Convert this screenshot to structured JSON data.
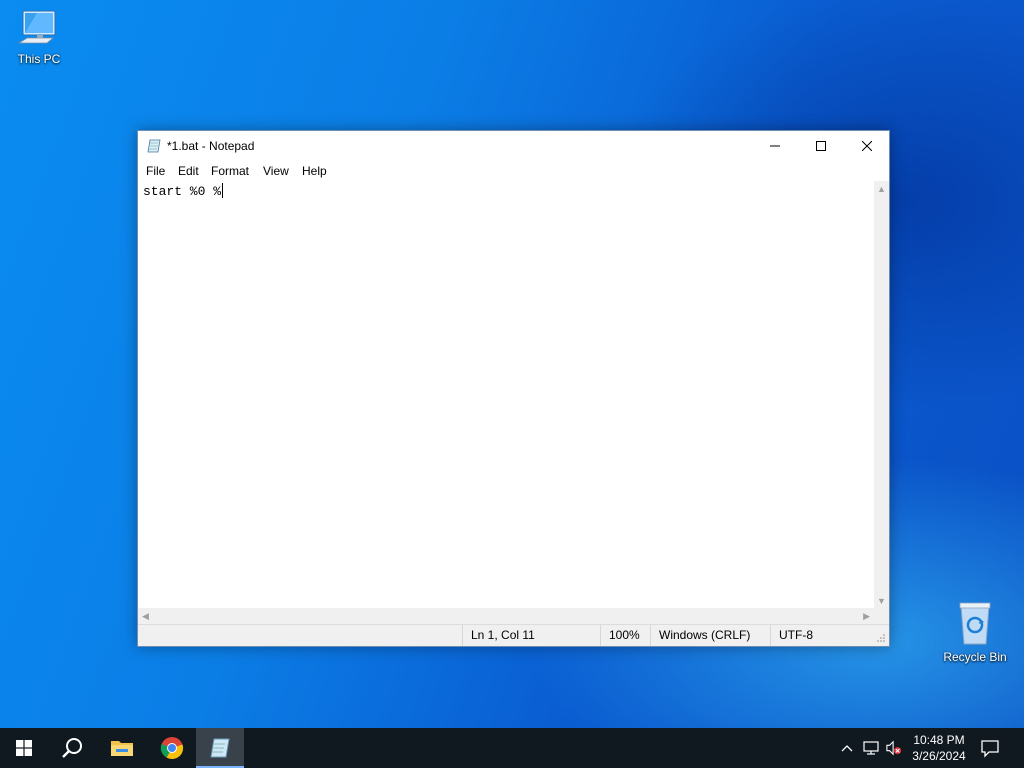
{
  "desktop": {
    "icons": [
      {
        "label": "This PC",
        "icon": "computer-icon"
      },
      {
        "label": "Recycle Bin",
        "icon": "recycle-bin-icon"
      }
    ]
  },
  "window": {
    "title": "*1.bat - Notepad",
    "app_icon": "notepad-icon",
    "controls": {
      "minimize": "minimize-icon",
      "maximize": "maximize-icon",
      "close": "close-icon"
    },
    "menu": [
      "File",
      "Edit",
      "Format",
      "View",
      "Help"
    ],
    "editor_text": "start %0 %",
    "status": {
      "position": "Ln 1, Col 11",
      "zoom": "100%",
      "line_ending": "Windows (CRLF)",
      "encoding": "UTF-8"
    }
  },
  "taskbar": {
    "apps": [
      "windows-start-icon",
      "search-icon",
      "file-explorer-icon",
      "chrome-icon",
      "notepad-icon"
    ],
    "tray": [
      "chevron-up-icon",
      "network-icon",
      "volume-muted-icon"
    ],
    "clock": {
      "time": "10:48 PM",
      "date": "3/26/2024"
    },
    "action_center": "notification-icon"
  },
  "colors": {
    "desktop_blue": "#0a7ee6",
    "taskbar": "#101820",
    "window_border": "#6f8db3"
  }
}
